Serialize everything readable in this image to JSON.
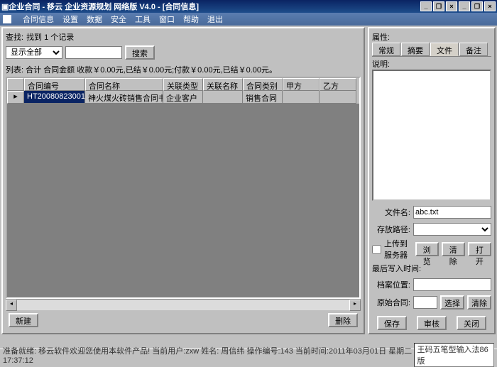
{
  "title": "企业合同 - 移云 企业资源规划 网络版 V4.0 - [合同信息]",
  "menu": {
    "m1": "合同信息",
    "m2": "设置",
    "m3": "数据",
    "m4": "安全",
    "m5": "工具",
    "m6": "窗口",
    "m7": "帮助",
    "m8": "退出"
  },
  "search": {
    "label": "查找:",
    "result": "找到 1 个记录",
    "filter": "显示全部",
    "btn": "搜索"
  },
  "summary": "列表: 合计 合同金额 收款￥0.00元,已结￥0.00元;付款￥0.00元,已结￥0.00元。",
  "headers": {
    "h1": "合同编号",
    "h2": "合同名称",
    "h3": "关联类型",
    "h4": "关联名称",
    "h5": "合同类别",
    "h6": "甲方",
    "h7": "乙方"
  },
  "row": {
    "c1": "HT20080823001",
    "c2": "神火煤火砖销售合同书",
    "c3": "企业客户",
    "c4": "",
    "c5": "销售合同",
    "c6": "",
    "c7": ""
  },
  "btns": {
    "new": "新建",
    "del": "删除"
  },
  "props": {
    "title": "属性:",
    "t1": "常规",
    "t2": "摘要",
    "t3": "文件",
    "t4": "备注",
    "desc": "说明:"
  },
  "file": {
    "name_lbl": "文件名:",
    "name": "abc.txt",
    "path_lbl": "存放路径:",
    "path": "",
    "upload": "上传到服务器",
    "browse": "浏览",
    "clear": "清除",
    "open": "打开",
    "lastwrite": "最后写入时间:",
    "archive_lbl": "档案位置:",
    "archive": "",
    "orig_lbl": "原始合同:",
    "orig": "",
    "select": "选择"
  },
  "rbtns": {
    "save": "保存",
    "audit": "审核",
    "close": "关闭"
  },
  "status": {
    "text": "准备就绪: 移云软件欢迎您使用本软件产品! 当前用户:zxw 姓名: 周信纬 操作编号:143 当前时间:2011年03月01日 星期二 17:37:12",
    "ime": "王码五笔型输入法86版"
  }
}
